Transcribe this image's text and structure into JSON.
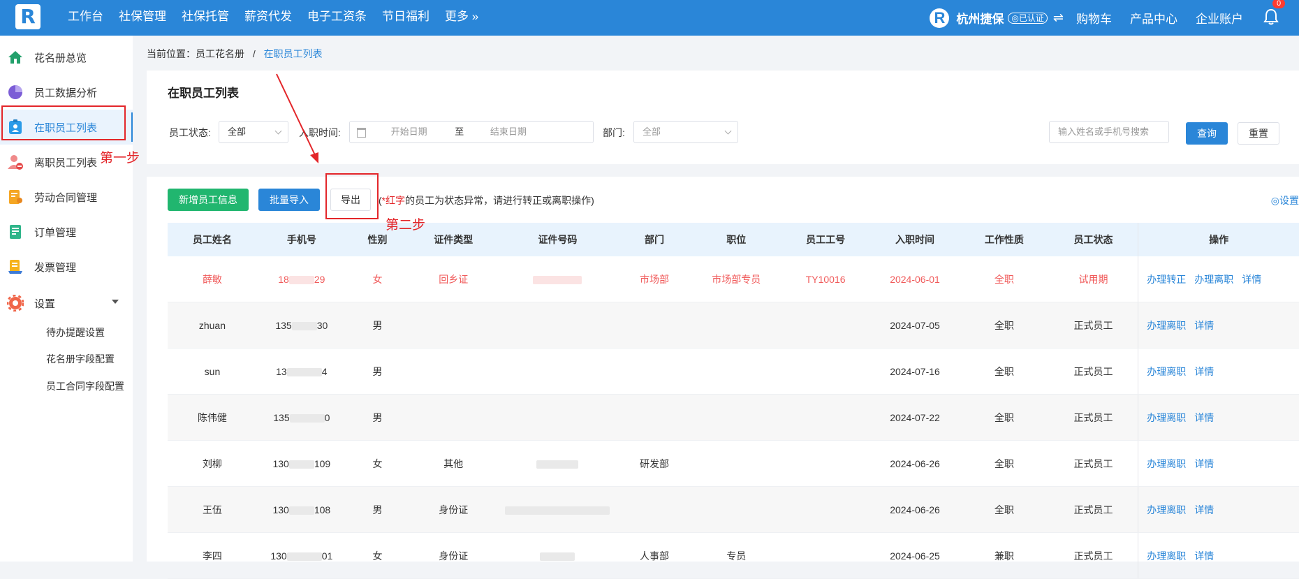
{
  "topbar": {
    "logo": "R",
    "nav": [
      "工作台",
      "社保管理",
      "社保托管",
      "薪资代发",
      "电子工资条",
      "节日福利",
      "更多 »"
    ],
    "company": "杭州捷保",
    "auth_badge": "◎已认证",
    "switch_glyph": "⇌",
    "right": [
      "购物车",
      "产品中心",
      "企业账户"
    ],
    "notify_count": "0",
    "accent": "#2a86d8"
  },
  "sidebar": {
    "items": [
      {
        "label": "花名册总览",
        "icon": "home-icon"
      },
      {
        "label": "员工数据分析",
        "icon": "pie-chart-icon"
      },
      {
        "label": "在职员工列表",
        "icon": "id-badge-icon"
      },
      {
        "label": "离职员工列表",
        "icon": "user-remove-icon"
      },
      {
        "label": "劳动合同管理",
        "icon": "contract-icon"
      },
      {
        "label": "订单管理",
        "icon": "order-icon"
      },
      {
        "label": "发票管理",
        "icon": "invoice-icon"
      },
      {
        "label": "设置",
        "icon": "gear-icon"
      }
    ],
    "sub_items": [
      "待办提醒设置",
      "花名册字段配置",
      "员工合同字段配置"
    ]
  },
  "annotations": {
    "step1": "第一步",
    "step2": "第二步"
  },
  "breadcrumb": {
    "prefix": "当前位置：员工花名册",
    "sep": "/",
    "current": "在职员工列表"
  },
  "filters": {
    "title": "在职员工列表",
    "status_label": "员工状态:",
    "status_value": "全部",
    "date_label": "入职时间:",
    "start_placeholder": "开始日期",
    "to": "至",
    "end_placeholder": "结束日期",
    "dept_label": "部门:",
    "dept_placeholder": "全部",
    "search_placeholder": "输入姓名或手机号搜索",
    "query": "查询",
    "reset": "重置"
  },
  "actions": {
    "add": "新增员工信息",
    "import": "批量导入",
    "export": "导出",
    "note_open": "(",
    "note_red": "*红字",
    "note_rest": "的员工为状态异常，请进行转正或离职操作)",
    "settings": "◎设置"
  },
  "table": {
    "columns": [
      "员工姓名",
      "手机号",
      "性别",
      "证件类型",
      "证件号码",
      "部门",
      "职位",
      "员工工号",
      "入职时间",
      "工作性质",
      "员工状态",
      "操作"
    ],
    "rows": [
      {
        "name": "薛敏",
        "phone_a": "18",
        "phone_b": "29",
        "gender": "女",
        "id_type": "回乡证",
        "dept": "市场部",
        "position": "市场部专员",
        "emp_no": "TY10016",
        "date": "2024-06-01",
        "nature": "全职",
        "status": "试用期",
        "ops": [
          "办理转正",
          "办理离职",
          "详情"
        ]
      },
      {
        "name": "zhuan",
        "phone_a": "135",
        "phone_b": "30",
        "gender": "男",
        "id_type": "",
        "dept": "",
        "position": "",
        "emp_no": "",
        "date": "2024-07-05",
        "nature": "全职",
        "status": "正式员工",
        "ops": [
          "办理离职",
          "详情"
        ]
      },
      {
        "name": "sun",
        "phone_a": "13",
        "phone_b": "4",
        "gender": "男",
        "id_type": "",
        "dept": "",
        "position": "",
        "emp_no": "",
        "date": "2024-07-16",
        "nature": "全职",
        "status": "正式员工",
        "ops": [
          "办理离职",
          "详情"
        ]
      },
      {
        "name": "陈伟健",
        "phone_a": "135",
        "phone_b": "0",
        "gender": "男",
        "id_type": "",
        "dept": "",
        "position": "",
        "emp_no": "",
        "date": "2024-07-22",
        "nature": "全职",
        "status": "正式员工",
        "ops": [
          "办理离职",
          "详情"
        ]
      },
      {
        "name": "刘柳",
        "phone_a": "130",
        "phone_b": "109",
        "gender": "女",
        "id_type": "其他",
        "dept": "研发部",
        "position": "",
        "emp_no": "",
        "date": "2024-06-26",
        "nature": "全职",
        "status": "正式员工",
        "ops": [
          "办理离职",
          "详情"
        ]
      },
      {
        "name": "王伍",
        "phone_a": "130",
        "phone_b": "108",
        "gender": "男",
        "id_type": "身份证",
        "dept": "",
        "position": "",
        "emp_no": "",
        "date": "2024-06-26",
        "nature": "全职",
        "status": "正式员工",
        "ops": [
          "办理离职",
          "详情"
        ]
      },
      {
        "name": "李四",
        "phone_a": "130",
        "phone_b": "01",
        "gender": "女",
        "id_type": "身份证",
        "dept": "人事部",
        "position": "专员",
        "emp_no": "",
        "date": "2024-06-25",
        "nature": "兼职",
        "status": "正式员工",
        "ops": [
          "办理离职",
          "详情"
        ]
      }
    ]
  }
}
